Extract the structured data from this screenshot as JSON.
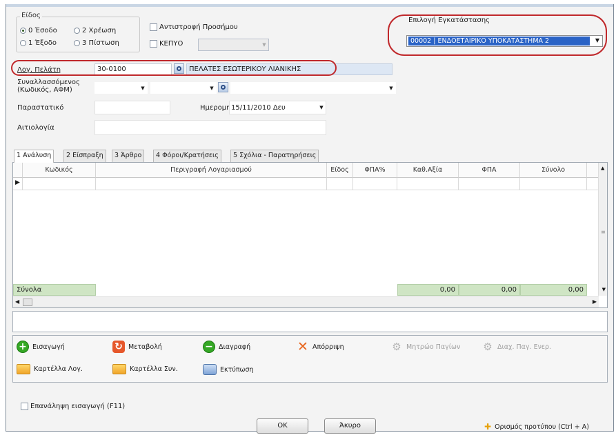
{
  "type_group": {
    "title": "Είδος",
    "options": [
      "0 Έσοδο",
      "2 Χρέωση",
      "1 Έξοδο",
      "3 Πίστωση"
    ]
  },
  "reverse_sign_label": "Αντιστροφή Προσήμου",
  "kepyo_label": "ΚΕΠΥΟ",
  "installation": {
    "label": "Επιλογή Εγκατάστασης",
    "selected": "00002 | ΕΝΔΟΕΤΑΙΡΙΚΟ ΥΠΟΚΑΤΑΣΤΗΜΑ 2"
  },
  "customer": {
    "label": "Λογ. Πελάτη",
    "code": "30-0100",
    "name": "ΠΕΛΑΤΕΣ ΕΣΩΤΕΡΙΚΟΥ ΛΙΑΝΙΚΗΣ"
  },
  "counterparty_label": "Συναλλασσόμενος (Κωδικός, ΑΦΜ)",
  "document_label": "Παραστατικό",
  "date": {
    "label": "Ημερομηνία",
    "value": "15/11/2010 Δευ"
  },
  "justification_label": "Αιτιολογία",
  "tabs": [
    "1 Ανάλυση",
    "2 Είσπραξη",
    "3 Άρθρο",
    "4 Φόροι/Κρατήσεις",
    "5 Σχόλια - Παρατηρήσεις"
  ],
  "grid": {
    "columns": [
      "Κωδικός",
      "Περιγραφή Λογαριασμού",
      "Είδος",
      "ΦΠΑ%",
      "Καθ.Αξία",
      "ΦΠΑ",
      "Σύνολο"
    ],
    "totals_label": "Σύνολα",
    "totals": [
      "0,00",
      "0,00",
      "0,00"
    ]
  },
  "actions": {
    "insert": "Εισαγωγή",
    "change": "Μεταβολή",
    "delete": "Διαγραφή",
    "reject": "Απόρριψη",
    "asset_registry": "Μητρώο Παγίων",
    "asset_disposal": "Διαχ. Παγ. Ενερ.",
    "account_card": "Καρτέλλα Λογ.",
    "counterparty_card": "Καρτέλλα Συν.",
    "print": "Εκτύπωση"
  },
  "repeat_entry_label": "Επανάληψη εισαγωγή (F11)",
  "buttons": {
    "ok": "OK",
    "cancel": "Άκυρο"
  },
  "template_link": "Ορισμός προτύπου (Ctrl + A)"
}
